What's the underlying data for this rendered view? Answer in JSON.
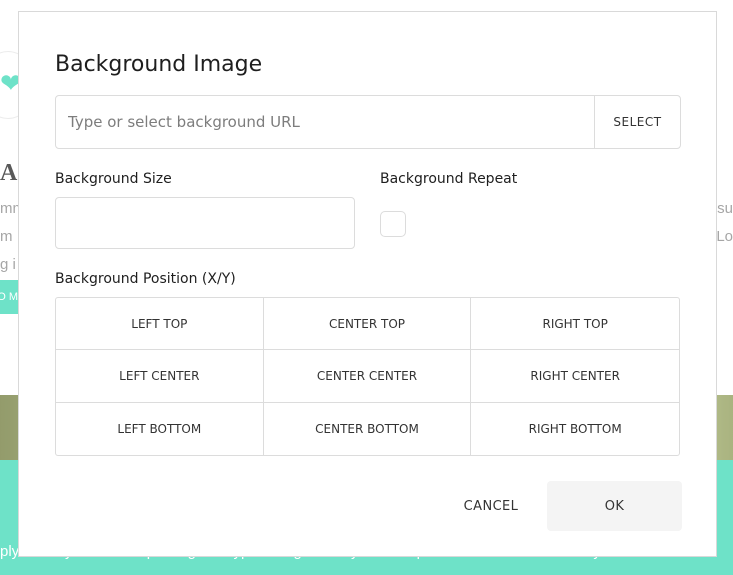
{
  "background_page": {
    "heading_letter": "A",
    "left_lines": [
      "mm",
      "m",
      "g i"
    ],
    "right_lines": [
      "osu",
      "Lo"
    ],
    "button_fragment": "O  M",
    "footer_text": "ply dummy text of the printing and typesetting industry. Lorem Ipsum has been the industry's standard"
  },
  "dialog": {
    "title": "Background Image",
    "url": {
      "value": "",
      "placeholder": "Type or select background URL",
      "select_label": "SELECT"
    },
    "size": {
      "label": "Background Size",
      "value": ""
    },
    "repeat": {
      "label": "Background Repeat",
      "checked": false
    },
    "position": {
      "label": "Background Position (X/Y)",
      "options": [
        "LEFT TOP",
        "CENTER TOP",
        "RIGHT TOP",
        "LEFT CENTER",
        "CENTER CENTER",
        "RIGHT CENTER",
        "LEFT BOTTOM",
        "CENTER BOTTOM",
        "RIGHT BOTTOM"
      ]
    },
    "buttons": {
      "cancel": "CANCEL",
      "ok": "OK"
    }
  },
  "colors": {
    "accent_teal": "#3ed9b6",
    "ok_button_bg": "#f4f4f4",
    "border": "#dcdcdc"
  },
  "icons": {
    "heart": "heart-icon"
  }
}
